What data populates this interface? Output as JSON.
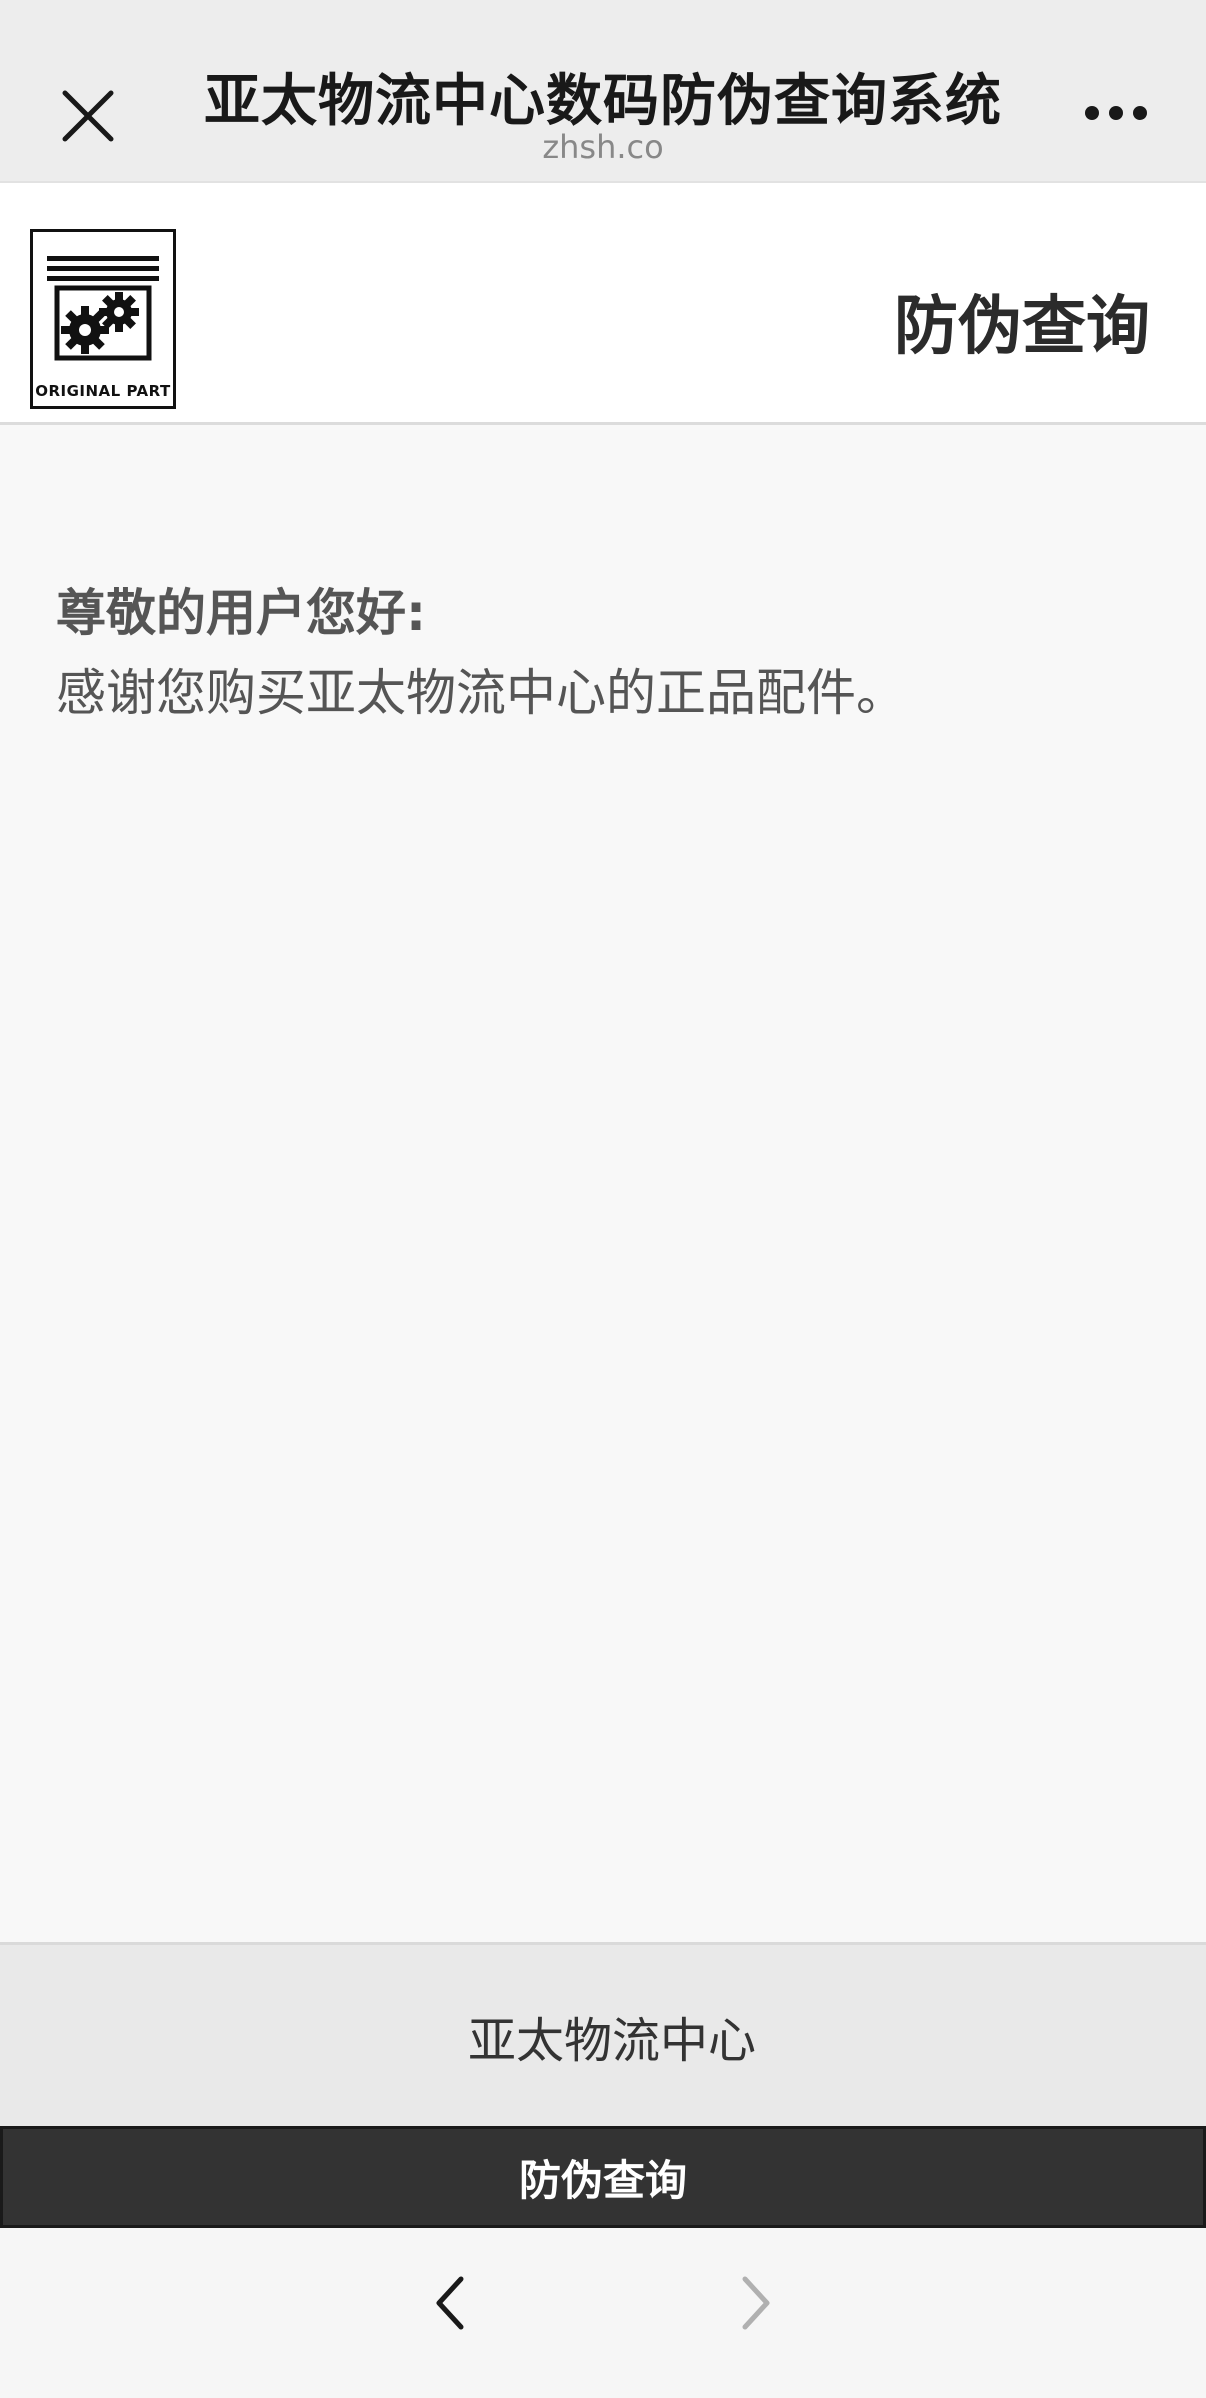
{
  "topbar": {
    "title": "亚太物流中心数码防伪查询系统",
    "subtitle": "zhsh.co",
    "close_icon": "close-icon",
    "more_icon": "more-dots-icon"
  },
  "header": {
    "logo_text": "ORIGINAL PART",
    "heading": "防伪查询"
  },
  "main": {
    "greeting": "尊敬的用户您好:",
    "thanks": "感谢您购买亚太物流中心的正品配件。"
  },
  "footer": {
    "brand": "亚太物流中心",
    "query_button": "防伪查询"
  },
  "navbar": {
    "back_icon": "chevron-left-icon",
    "forward_icon": "chevron-right-icon"
  },
  "colors": {
    "topbar_bg": "#ededed",
    "button_bg": "#333333",
    "footer_bg": "#e9e9e9"
  }
}
